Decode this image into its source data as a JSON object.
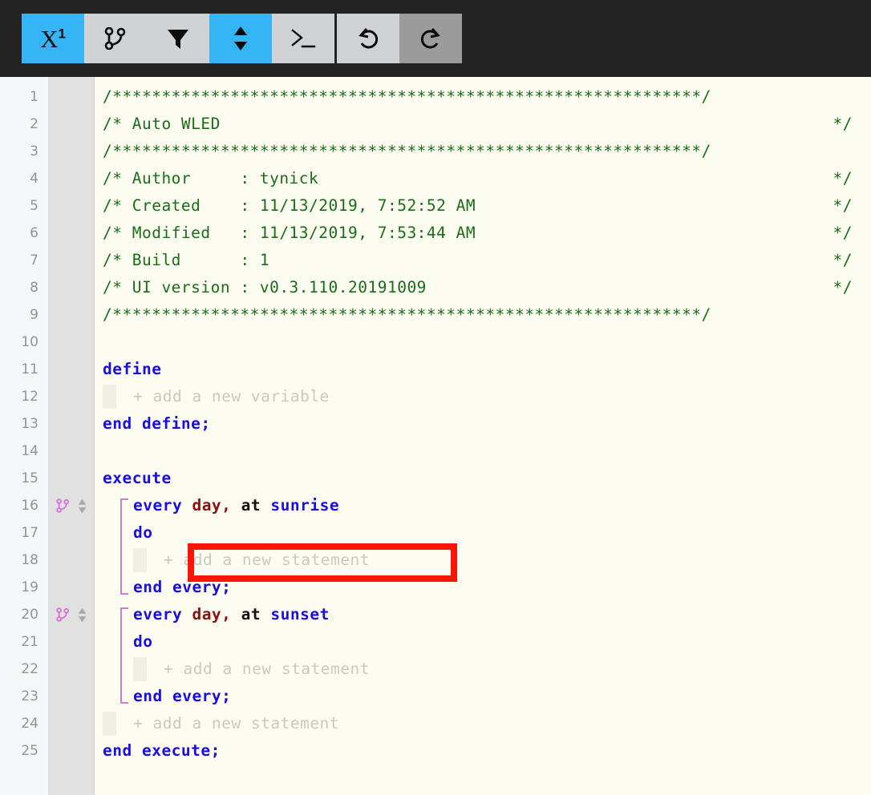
{
  "toolbar": {
    "groups": [
      {
        "name": "main",
        "buttons": [
          {
            "icon": "variable-superscript-icon",
            "label": "X¹",
            "state": "active"
          },
          {
            "icon": "git-branch-icon",
            "label": "",
            "state": "normal"
          },
          {
            "icon": "filter-funnel-icon",
            "label": "",
            "state": "normal"
          },
          {
            "icon": "sort-updown-icon",
            "label": "",
            "state": "active"
          },
          {
            "icon": "terminal-prompt-icon",
            "label": "",
            "state": "normal"
          }
        ]
      },
      {
        "name": "history",
        "buttons": [
          {
            "icon": "undo-icon",
            "label": "",
            "state": "normal"
          },
          {
            "icon": "redo-icon",
            "label": "",
            "state": "pressed"
          }
        ]
      }
    ]
  },
  "colors": {
    "toolbar_bg": "#232323",
    "button_bg": "#d0d2d3",
    "button_active": "#35b5f5",
    "button_pressed": "#9b9b9b",
    "editor_bg": "#fdfcf0",
    "gutter_num_bg": "#f6f7f8",
    "gutter_icon_bg": "#e1e1e1",
    "comment": "#186d18",
    "keyword": "#1a0fe0",
    "literal": "#8b1111",
    "placeholder": "#c9c9c4",
    "bracket": "#d07ad0",
    "annotation": "#fa1506"
  },
  "editor": {
    "line_numbers": [
      1,
      2,
      3,
      4,
      5,
      6,
      7,
      8,
      9,
      10,
      11,
      12,
      13,
      14,
      15,
      16,
      17,
      18,
      19,
      20,
      21,
      22,
      23,
      24,
      25
    ],
    "lines": [
      {
        "n": 1,
        "indent": 0,
        "tokens": [
          {
            "t": "/**********************************************************",
            "c": "cmt"
          },
          {
            "t": "**/",
            "c": "cmt"
          }
        ]
      },
      {
        "n": 2,
        "indent": 0,
        "tokens": [
          {
            "t": "/* Auto WLED",
            "c": "cmt"
          }
        ],
        "right": "*/"
      },
      {
        "n": 3,
        "indent": 0,
        "tokens": [
          {
            "t": "/**********************************************************",
            "c": "cmt"
          },
          {
            "t": "**/",
            "c": "cmt"
          }
        ]
      },
      {
        "n": 4,
        "indent": 0,
        "tokens": [
          {
            "t": "/* Author     : tynick",
            "c": "cmt"
          }
        ],
        "right": "*/"
      },
      {
        "n": 5,
        "indent": 0,
        "tokens": [
          {
            "t": "/* Created    : 11/13/2019, 7:52:52 AM",
            "c": "cmt"
          }
        ],
        "right": "*/"
      },
      {
        "n": 6,
        "indent": 0,
        "tokens": [
          {
            "t": "/* Modified   : 11/13/2019, 7:53:44 AM",
            "c": "cmt"
          }
        ],
        "right": "*/"
      },
      {
        "n": 7,
        "indent": 0,
        "tokens": [
          {
            "t": "/* Build      : 1",
            "c": "cmt"
          }
        ],
        "right": "*/"
      },
      {
        "n": 8,
        "indent": 0,
        "tokens": [
          {
            "t": "/* UI version : v0.3.110.20191009",
            "c": "cmt"
          }
        ],
        "right": "*/"
      },
      {
        "n": 9,
        "indent": 0,
        "tokens": [
          {
            "t": "/**********************************************************",
            "c": "cmt"
          },
          {
            "t": "**/",
            "c": "cmt"
          }
        ]
      },
      {
        "n": 10,
        "indent": 0,
        "tokens": []
      },
      {
        "n": 11,
        "indent": 0,
        "tokens": [
          {
            "t": "define",
            "c": "kw"
          }
        ]
      },
      {
        "n": 12,
        "indent": 1,
        "tokens": [
          {
            "t": "+ add a new variable",
            "c": "ph"
          }
        ]
      },
      {
        "n": 13,
        "indent": 0,
        "tokens": [
          {
            "t": "end define;",
            "c": "kw"
          }
        ]
      },
      {
        "n": 14,
        "indent": 0,
        "tokens": []
      },
      {
        "n": 15,
        "indent": 0,
        "tokens": [
          {
            "t": "execute",
            "c": "kw"
          }
        ]
      },
      {
        "n": 16,
        "indent": 1,
        "tokens": [
          {
            "t": "every ",
            "c": "kw"
          },
          {
            "t": "day,",
            "c": "lit"
          },
          {
            "t": " at ",
            "c": "plain"
          },
          {
            "t": "sunrise",
            "c": "kw"
          }
        ]
      },
      {
        "n": 17,
        "indent": 1,
        "tokens": [
          {
            "t": "do",
            "c": "kw"
          }
        ]
      },
      {
        "n": 18,
        "indent": 2,
        "tokens": [
          {
            "t": "+ add a new statement",
            "c": "ph"
          }
        ]
      },
      {
        "n": 19,
        "indent": 1,
        "tokens": [
          {
            "t": "end every;",
            "c": "kw"
          }
        ]
      },
      {
        "n": 20,
        "indent": 1,
        "tokens": [
          {
            "t": "every ",
            "c": "kw"
          },
          {
            "t": "day,",
            "c": "lit"
          },
          {
            "t": " at ",
            "c": "plain"
          },
          {
            "t": "sunset",
            "c": "kw"
          }
        ]
      },
      {
        "n": 21,
        "indent": 1,
        "tokens": [
          {
            "t": "do",
            "c": "kw"
          }
        ]
      },
      {
        "n": 22,
        "indent": 2,
        "tokens": [
          {
            "t": "+ add a new statement",
            "c": "ph"
          }
        ]
      },
      {
        "n": 23,
        "indent": 1,
        "tokens": [
          {
            "t": "end every;",
            "c": "kw"
          }
        ]
      },
      {
        "n": 24,
        "indent": 1,
        "tokens": [
          {
            "t": "+ add a new statement",
            "c": "ph"
          }
        ]
      },
      {
        "n": 25,
        "indent": 0,
        "tokens": [
          {
            "t": "end execute;",
            "c": "kw"
          }
        ]
      }
    ],
    "gutter_markers": [
      {
        "line": 16,
        "icons": [
          "git-branch-icon",
          "sort-updown-icon"
        ]
      },
      {
        "line": 20,
        "icons": [
          "git-branch-icon",
          "sort-updown-icon"
        ]
      }
    ],
    "blocks": [
      {
        "from": 16,
        "to": 19
      },
      {
        "from": 20,
        "to": 23
      }
    ],
    "annotation": {
      "target_line": 18,
      "target_text": "+ add a new statement"
    }
  }
}
